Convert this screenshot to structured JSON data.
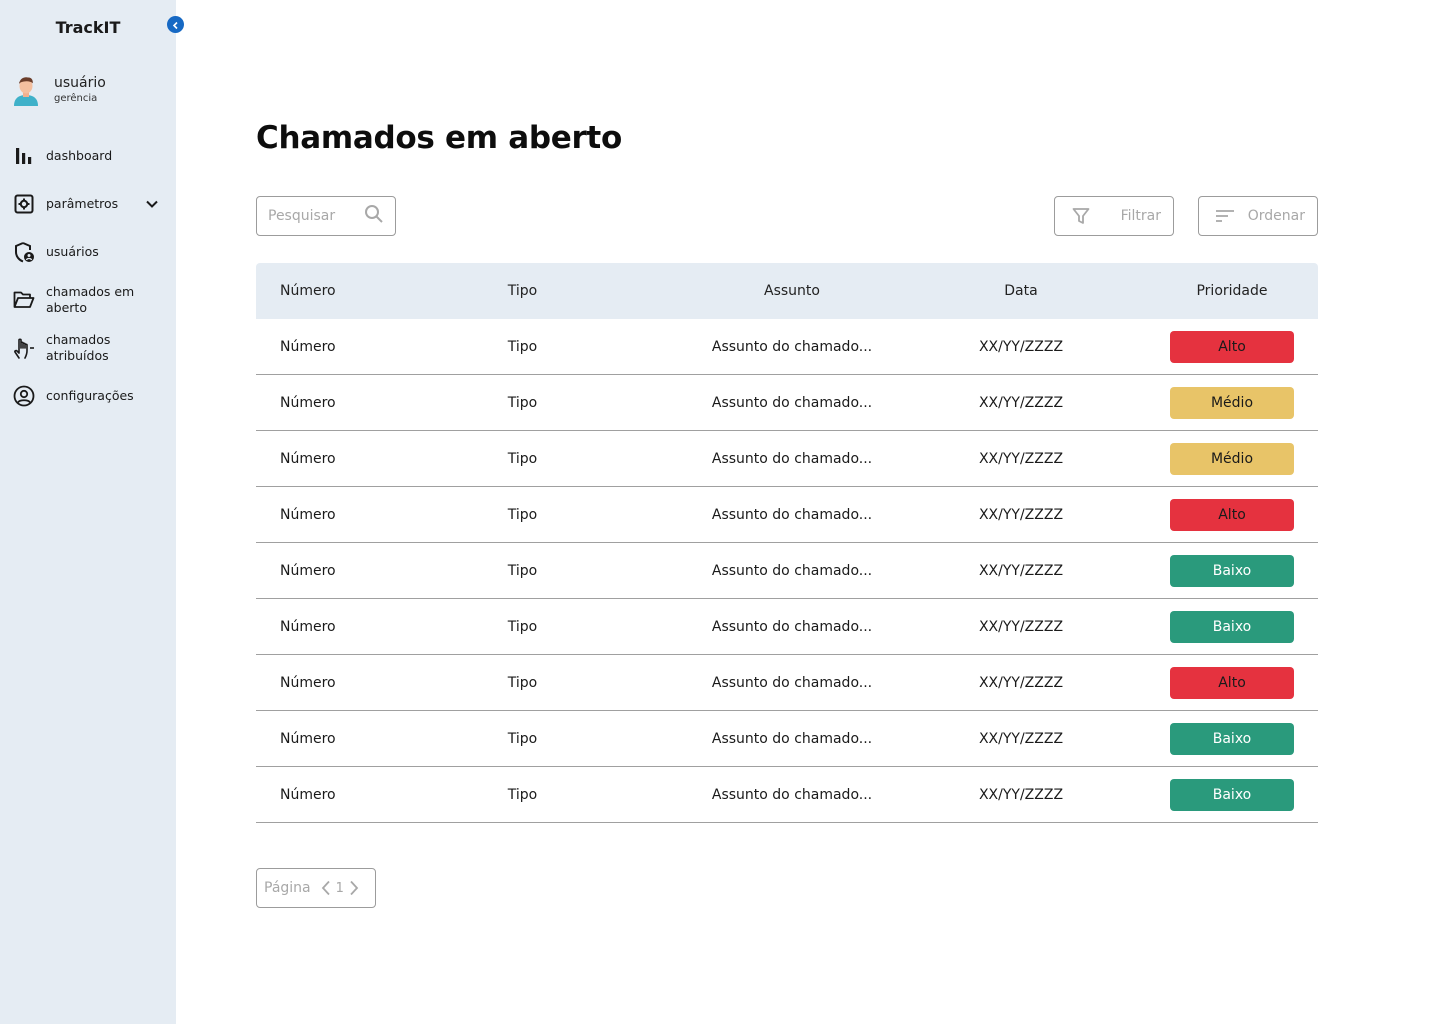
{
  "app": {
    "name": "TrackIT"
  },
  "sidebar": {
    "user": {
      "name": "usuário",
      "role": "gerência"
    },
    "items": [
      {
        "label": "dashboard",
        "icon": "bar-chart-icon"
      },
      {
        "label": "parâmetros",
        "icon": "settings-square-icon",
        "has_dropdown": true
      },
      {
        "label": "usuários",
        "icon": "shield-user-icon"
      },
      {
        "label": "chamados em aberto",
        "icon": "folder-open-icon"
      },
      {
        "label": "chamados atribuídos",
        "icon": "hand-icon"
      },
      {
        "label": "configurações",
        "icon": "user-circle-icon"
      }
    ]
  },
  "main": {
    "title": "Chamados em aberto",
    "search": {
      "placeholder": "Pesquisar"
    },
    "filter_label": "Filtrar",
    "order_label": "Ordenar",
    "table": {
      "headers": [
        "Número",
        "Tipo",
        "Assunto",
        "Data",
        "Prioridade"
      ],
      "rows": [
        {
          "numero": "Número",
          "tipo": "Tipo",
          "assunto": "Assunto do chamado...",
          "data": "XX/YY/ZZZZ",
          "prioridade": "Alto"
        },
        {
          "numero": "Número",
          "tipo": "Tipo",
          "assunto": "Assunto do chamado...",
          "data": "XX/YY/ZZZZ",
          "prioridade": "Médio"
        },
        {
          "numero": "Número",
          "tipo": "Tipo",
          "assunto": "Assunto do chamado...",
          "data": "XX/YY/ZZZZ",
          "prioridade": "Médio"
        },
        {
          "numero": "Número",
          "tipo": "Tipo",
          "assunto": "Assunto do chamado...",
          "data": "XX/YY/ZZZZ",
          "prioridade": "Alto"
        },
        {
          "numero": "Número",
          "tipo": "Tipo",
          "assunto": "Assunto do chamado...",
          "data": "XX/YY/ZZZZ",
          "prioridade": "Baixo"
        },
        {
          "numero": "Número",
          "tipo": "Tipo",
          "assunto": "Assunto do chamado...",
          "data": "XX/YY/ZZZZ",
          "prioridade": "Baixo"
        },
        {
          "numero": "Número",
          "tipo": "Tipo",
          "assunto": "Assunto do chamado...",
          "data": "XX/YY/ZZZZ",
          "prioridade": "Alto"
        },
        {
          "numero": "Número",
          "tipo": "Tipo",
          "assunto": "Assunto do chamado...",
          "data": "XX/YY/ZZZZ",
          "prioridade": "Baixo"
        },
        {
          "numero": "Número",
          "tipo": "Tipo",
          "assunto": "Assunto do chamado...",
          "data": "XX/YY/ZZZZ",
          "prioridade": "Baixo"
        }
      ]
    },
    "pagination": {
      "label": "Página",
      "current_page": "1"
    }
  },
  "colors": {
    "sidebar_bg": "#e5ecf3",
    "accent": "#1769c4",
    "priority": {
      "Alto": {
        "bg": "#e5323f",
        "fg": "#1a1a1a"
      },
      "Médio": {
        "bg": "#e8c468",
        "fg": "#1a1a1a"
      },
      "Baixo": {
        "bg": "#2a9a7c",
        "fg": "#ffffff"
      }
    }
  }
}
